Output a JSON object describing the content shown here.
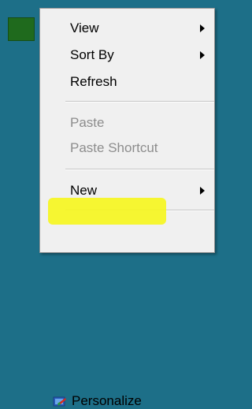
{
  "menu": {
    "items": [
      {
        "label": "View",
        "has_submenu": true,
        "enabled": true
      },
      {
        "label": "Sort By",
        "has_submenu": true,
        "enabled": true
      },
      {
        "label": "Refresh",
        "has_submenu": false,
        "enabled": true
      },
      {
        "label": "Paste",
        "has_submenu": false,
        "enabled": false
      },
      {
        "label": "Paste Shortcut",
        "has_submenu": false,
        "enabled": false
      },
      {
        "label": "New",
        "has_submenu": true,
        "enabled": true
      },
      {
        "label": "Personalize",
        "has_submenu": false,
        "enabled": true,
        "icon": "personalize-icon",
        "highlighted": true
      }
    ]
  },
  "colors": {
    "desktop": "#1d6f88",
    "menu_bg": "#f0f0f0",
    "disabled_text": "#8d8d8d",
    "highlight": "#f7f70f"
  }
}
